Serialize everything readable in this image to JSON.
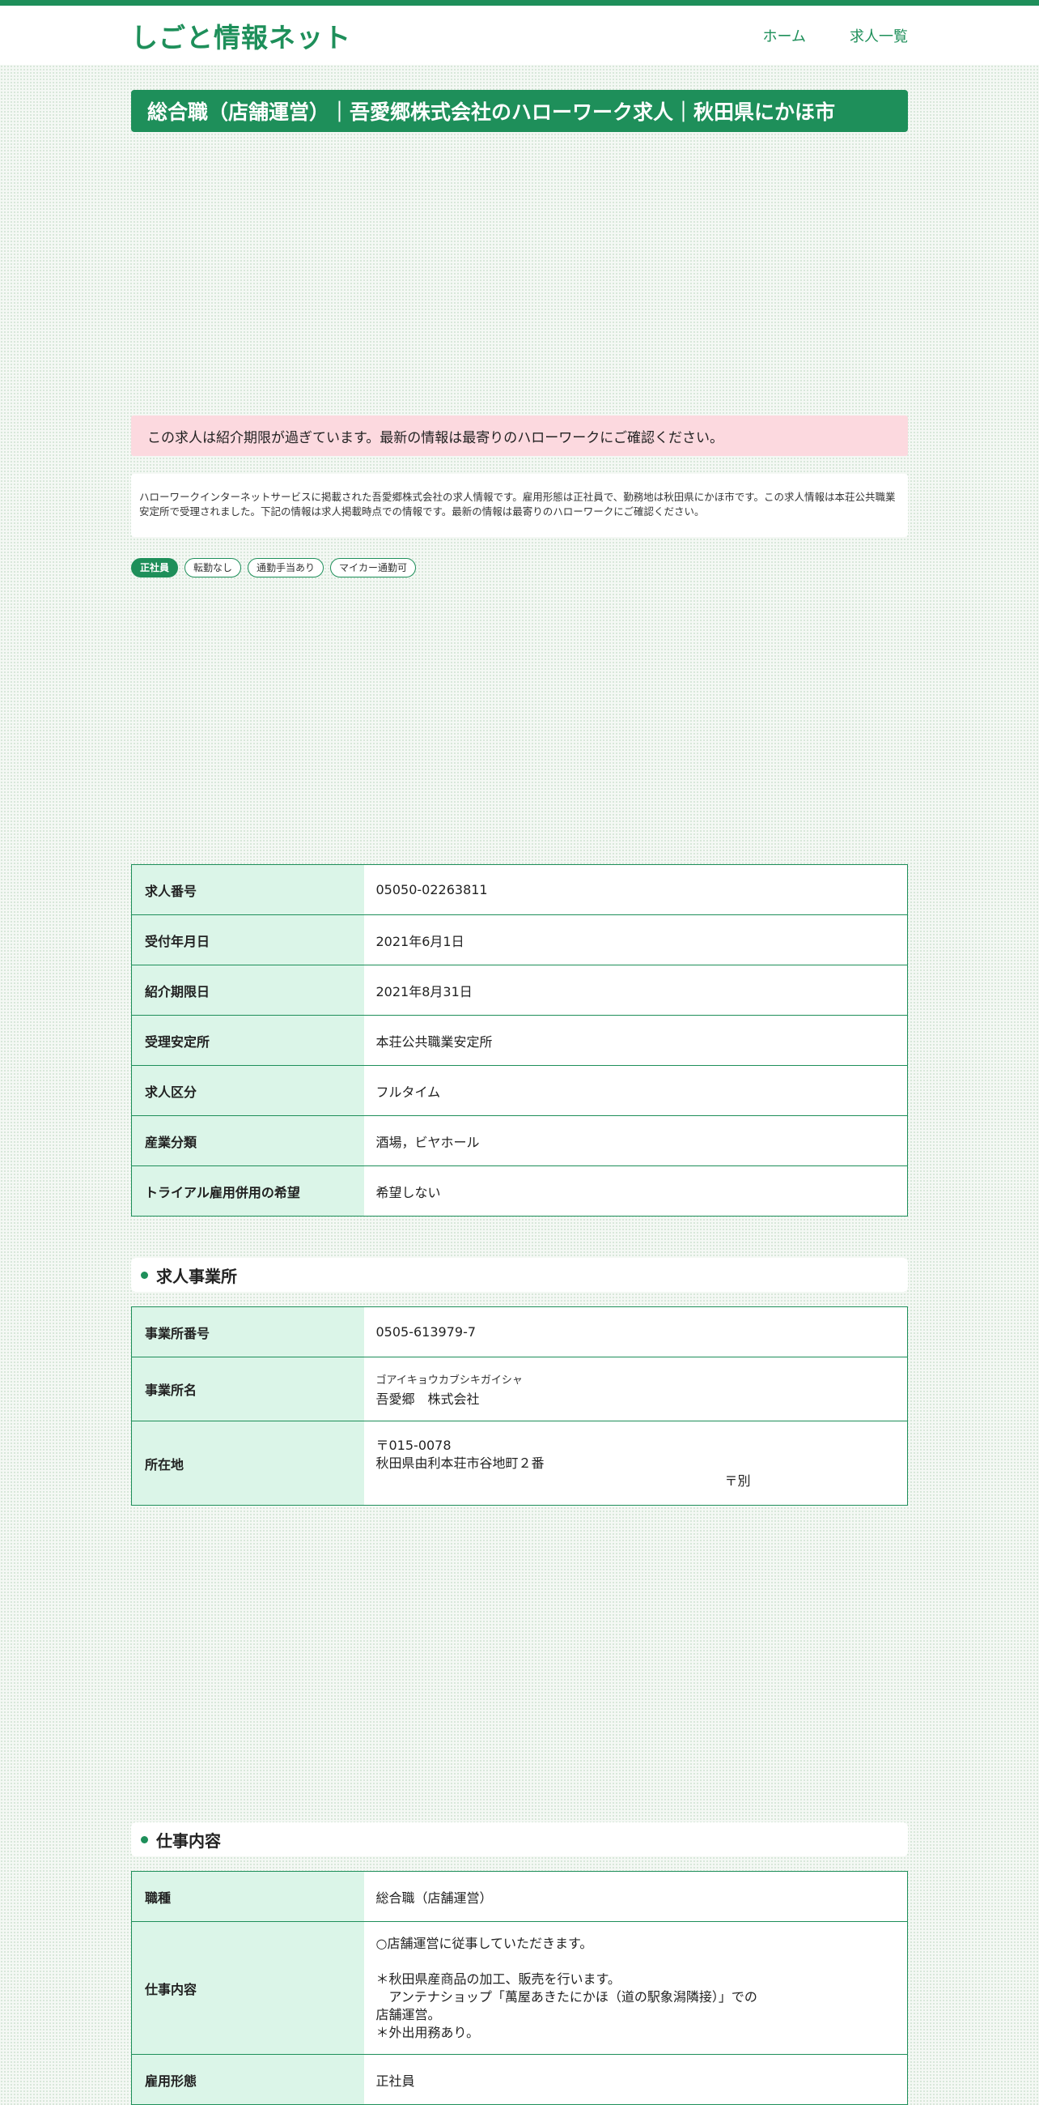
{
  "site": {
    "logo": "しごと情報ネット",
    "nav": [
      "ホーム",
      "求人一覧"
    ]
  },
  "title": "総合職（店舗運営）｜吾愛郷株式会社のハローワーク求人｜秋田県にかほ市",
  "notice": "この求人は紹介期限が過ぎています。最新の情報は最寄りのハローワークにご確認ください。",
  "description": "ハローワークインターネットサービスに掲載された吾愛郷株式会社の求人情報です。雇用形態は正社員で、勤務地は秋田県にかほ市です。この求人情報は本荘公共職業安定所で受理されました。下記の情報は求人掲載時点での情報です。最新の情報は最寄りのハローワークにご確認ください。",
  "tags": [
    "正社員",
    "転勤なし",
    "通勤手当あり",
    "マイカー通勤可"
  ],
  "summary_table": [
    {
      "label": "求人番号",
      "value": "05050-02263811"
    },
    {
      "label": "受付年月日",
      "value": "2021年6月1日"
    },
    {
      "label": "紹介期限日",
      "value": "2021年8月31日"
    },
    {
      "label": "受理安定所",
      "value": "本荘公共職業安定所"
    },
    {
      "label": "求人区分",
      "value": "フルタイム"
    },
    {
      "label": "産業分類",
      "value": "酒場，ビヤホール"
    },
    {
      "label": "トライアル雇用併用の希望",
      "value": "希望しない"
    }
  ],
  "office_section": {
    "heading": "求人事業所",
    "number_label": "事業所番号",
    "number_value": "0505-613979-7",
    "name_label": "事業所名",
    "name_kana": "ゴアイキョウカブシキガイシャ",
    "name_value": "吾愛郷　株式会社",
    "address_label": "所在地",
    "postal": "〒015-0078",
    "address": "秋田県由利本荘市谷地町２番",
    "address_note": "〒別"
  },
  "job_section": {
    "heading": "仕事内容",
    "type_label": "職種",
    "type_value": "総合職（店舗運営）",
    "content_label": "仕事内容",
    "content_value": "○店舗運営に従事していただきます。\n\n＊秋田県産商品の加工、販売を行います。\n　アンテナショップ「萬屋あきたにかほ（道の駅象潟隣接）」での\n店舗運営。\n＊外出用務あり。",
    "employment_label": "雇用形態",
    "employment_value": "正社員"
  },
  "colors": {
    "accent": "#1e8f5a",
    "label_bg": "#dbf5e8",
    "notice_bg": "#fcd9df"
  }
}
